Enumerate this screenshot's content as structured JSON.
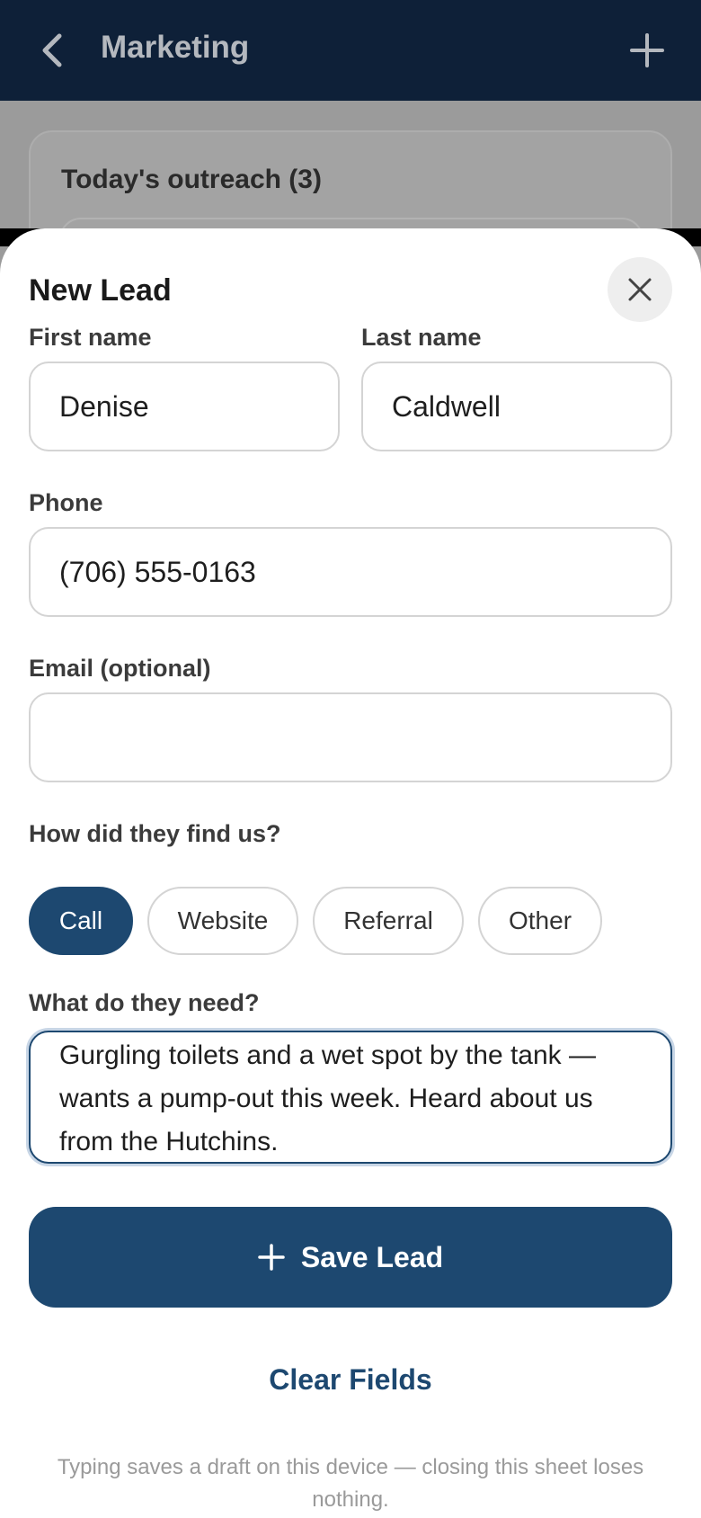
{
  "app": {
    "title": "Marketing",
    "back_icon": "chevron-left-icon",
    "add_icon": "plus-icon"
  },
  "background_card": {
    "title": "Today's outreach (3)"
  },
  "sheet": {
    "title": "New Lead",
    "close_icon": "close-icon",
    "first_name": {
      "label": "First name",
      "value": "Denise"
    },
    "last_name": {
      "label": "Last name",
      "value": "Caldwell"
    },
    "phone": {
      "label": "Phone",
      "value": "(706) 555-0163"
    },
    "email": {
      "label": "Email (optional)",
      "value": ""
    },
    "source": {
      "label": "How did they find us?",
      "options": [
        "Call",
        "Website",
        "Referral",
        "Other"
      ],
      "selected": "Call"
    },
    "need": {
      "label": "What do they need?",
      "value": "Gurgling toilets and a wet spot by the tank — wants a pump-out this week. Heard about us from the Hutchins."
    },
    "save_label": "Save Lead",
    "save_icon": "plus-icon",
    "clear_label": "Clear Fields",
    "footnote": "Typing saves a draft on this device — closing this sheet loses nothing."
  },
  "colors": {
    "topbar": "#0e2038",
    "accent": "#1d4870",
    "overlay": "#9b9b9b"
  }
}
